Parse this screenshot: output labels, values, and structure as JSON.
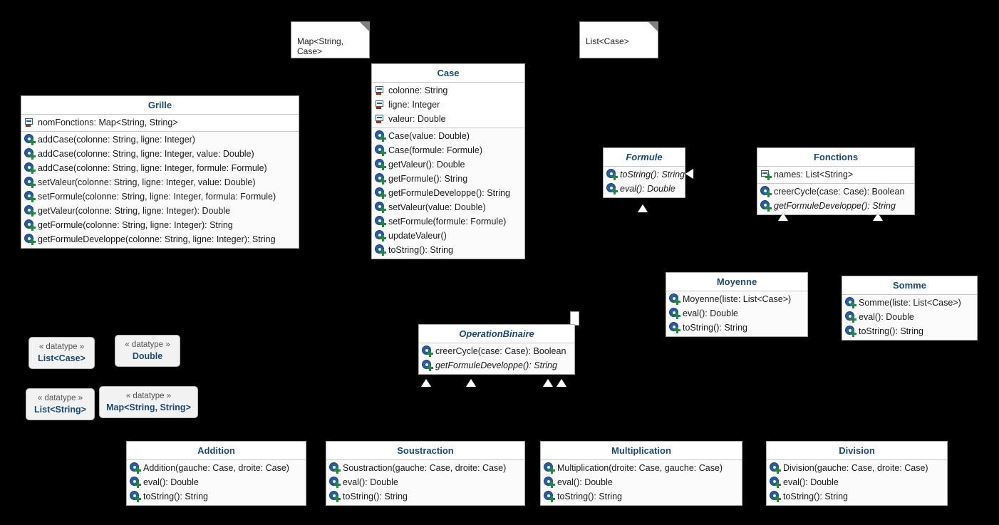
{
  "diagram": {
    "title": "UML Class Diagram",
    "background": "#000000",
    "accent_title": "#1b4a73",
    "box_fill": "#fbfbfb",
    "box_border": "#a8a8a8"
  },
  "notes": [
    {
      "text": "Map<String,\nCase>"
    },
    {
      "text": "List<Case>"
    }
  ],
  "classes": [
    {
      "name": "Grille",
      "abstract": false,
      "attributes": [
        {
          "label": "nomFonctions: Map<String, String>",
          "icon": "field-private-icon",
          "italic": false
        }
      ],
      "methods": [
        {
          "label": "addCase(colonne: String, ligne: Integer)",
          "icon": "method-public-icon",
          "italic": false
        },
        {
          "label": "addCase(colonne: String, ligne: Integer, value: Double)",
          "icon": "method-public-icon",
          "italic": false
        },
        {
          "label": "addCase(colonne: String, ligne: Integer, formule: Formule)",
          "icon": "method-public-icon",
          "italic": false
        },
        {
          "label": "setValeur(colonne: String, ligne: Integer, value: Double)",
          "icon": "method-public-icon",
          "italic": false
        },
        {
          "label": "setFormule(colonne: String, ligne: Integer, formula: Formule)",
          "icon": "method-public-icon",
          "italic": false
        },
        {
          "label": "getValeur(colonne: String, ligne: Integer): Double",
          "icon": "method-public-icon",
          "italic": false
        },
        {
          "label": "getFormule(colonne: String, ligne: Integer): String",
          "icon": "method-public-icon",
          "italic": false
        },
        {
          "label": "getFormuleDeveloppe(colonne: String, ligne: Integer): String",
          "icon": "method-public-icon",
          "italic": false
        }
      ]
    },
    {
      "name": "Case",
      "abstract": false,
      "attributes": [
        {
          "label": "colonne: String",
          "icon": "field-private-icon",
          "italic": false
        },
        {
          "label": "ligne: Integer",
          "icon": "field-private-icon",
          "italic": false
        },
        {
          "label": "valeur: Double",
          "icon": "field-private-icon",
          "italic": false
        }
      ],
      "methods": [
        {
          "label": "Case(value: Double)",
          "icon": "method-public-icon",
          "italic": false
        },
        {
          "label": "Case(formule: Formule)",
          "icon": "method-public-icon",
          "italic": false
        },
        {
          "label": "getValeur(): Double",
          "icon": "method-public-icon",
          "italic": false
        },
        {
          "label": "getFormule(): String",
          "icon": "method-public-icon",
          "italic": false
        },
        {
          "label": "getFormuleDeveloppe(): String",
          "icon": "method-public-icon",
          "italic": false
        },
        {
          "label": "setValeur(value: Double)",
          "icon": "method-public-icon",
          "italic": false
        },
        {
          "label": "setFormule(formule: Formule)",
          "icon": "method-public-icon",
          "italic": false
        },
        {
          "label": "updateValeur()",
          "icon": "method-public-icon",
          "italic": false
        },
        {
          "label": "toString(): String",
          "icon": "method-public-icon",
          "italic": false
        }
      ]
    },
    {
      "name": "Formule",
      "abstract": true,
      "attributes": [],
      "methods": [
        {
          "label": "toString(): String",
          "icon": "method-public-icon",
          "italic": true
        },
        {
          "label": "eval(): Double",
          "icon": "method-public-icon",
          "italic": true
        }
      ]
    },
    {
      "name": "Fonctions",
      "abstract": false,
      "attributes": [
        {
          "label": "names: List<String>",
          "icon": "field-public-icon",
          "italic": false
        }
      ],
      "methods": [
        {
          "label": "creerCycle(case: Case): Boolean",
          "icon": "method-public-icon",
          "italic": false
        },
        {
          "label": "getFormuleDeveloppe(): String",
          "icon": "method-public-icon",
          "italic": true
        }
      ]
    },
    {
      "name": "Moyenne",
      "abstract": false,
      "attributes": [],
      "methods": [
        {
          "label": "Moyenne(liste: List<Case>)",
          "icon": "method-public-icon",
          "italic": false
        },
        {
          "label": "eval(): Double",
          "icon": "method-public-icon",
          "italic": false
        },
        {
          "label": "toString(): String",
          "icon": "method-public-icon",
          "italic": false
        }
      ]
    },
    {
      "name": "Somme",
      "abstract": false,
      "attributes": [],
      "methods": [
        {
          "label": "Somme(liste: List<Case>)",
          "icon": "method-public-icon",
          "italic": false
        },
        {
          "label": "eval(): Double",
          "icon": "method-public-icon",
          "italic": false
        },
        {
          "label": "toString(): String",
          "icon": "method-public-icon",
          "italic": false
        }
      ]
    },
    {
      "name": "OperationBinaire",
      "abstract": true,
      "attributes": [],
      "methods": [
        {
          "label": "creerCycle(case: Case): Boolean",
          "icon": "method-public-icon",
          "italic": false
        },
        {
          "label": "getFormuleDeveloppe(): String",
          "icon": "method-public-icon",
          "italic": true
        }
      ]
    },
    {
      "name": "Addition",
      "abstract": false,
      "attributes": [],
      "methods": [
        {
          "label": "Addition(gauche: Case, droite: Case)",
          "icon": "method-public-icon",
          "italic": false
        },
        {
          "label": "eval(): Double",
          "icon": "method-public-icon",
          "italic": false
        },
        {
          "label": "toString(): String",
          "icon": "method-public-icon",
          "italic": false
        }
      ]
    },
    {
      "name": "Soustraction",
      "abstract": false,
      "attributes": [],
      "methods": [
        {
          "label": "Soustraction(gauche: Case, droite: Case)",
          "icon": "method-public-icon",
          "italic": false
        },
        {
          "label": "eval(): Double",
          "icon": "method-public-icon",
          "italic": false
        },
        {
          "label": "toString(): String",
          "icon": "method-public-icon",
          "italic": false
        }
      ]
    },
    {
      "name": "Multiplication",
      "abstract": false,
      "attributes": [],
      "methods": [
        {
          "label": "Multiplication(droite: Case, gauche: Case)",
          "icon": "method-public-icon",
          "italic": false
        },
        {
          "label": "eval(): Double",
          "icon": "method-public-icon",
          "italic": false
        },
        {
          "label": "toString(): String",
          "icon": "method-public-icon",
          "italic": false
        }
      ]
    },
    {
      "name": "Division",
      "abstract": false,
      "attributes": [],
      "methods": [
        {
          "label": "Division(gauche: Case, droite: Case)",
          "icon": "method-public-icon",
          "italic": false
        },
        {
          "label": "eval(): Double",
          "icon": "method-public-icon",
          "italic": false
        },
        {
          "label": "toString(): String",
          "icon": "method-public-icon",
          "italic": false
        }
      ]
    }
  ],
  "datatypes": [
    {
      "stereotype": "« datatype »",
      "name": "List<Case>"
    },
    {
      "stereotype": "« datatype »",
      "name": "Double"
    },
    {
      "stereotype": "« datatype »",
      "name": "List<String>"
    },
    {
      "stereotype": "« datatype »",
      "name": "Map<String, String>"
    }
  ]
}
